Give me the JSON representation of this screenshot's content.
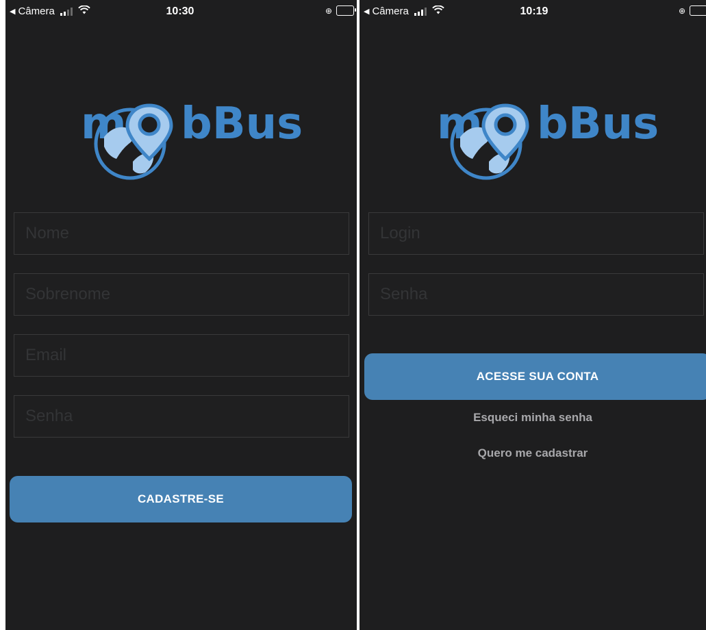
{
  "colors": {
    "background": "#1e1e1f",
    "accent": "#4682b4",
    "field_border": "#3a3a3b",
    "link_text": "#a8a8ab"
  },
  "logo": {
    "text": "mobBus",
    "icons": [
      "globe-icon",
      "map-pin-icon"
    ]
  },
  "left_screen": {
    "status_bar": {
      "back_label": "Câmera",
      "time": "10:30"
    },
    "fields": [
      {
        "placeholder": "Nome"
      },
      {
        "placeholder": "Sobrenome"
      },
      {
        "placeholder": "Email"
      },
      {
        "placeholder": "Senha"
      }
    ],
    "submit_label": "CADASTRE-SE"
  },
  "right_screen": {
    "status_bar": {
      "back_label": "Câmera",
      "time": "10:19"
    },
    "fields": [
      {
        "placeholder": "Login"
      },
      {
        "placeholder": "Senha"
      }
    ],
    "submit_label": "ACESSE SUA CONTA",
    "forgot_link": "Esqueci minha senha",
    "register_link": "Quero me cadastrar"
  }
}
